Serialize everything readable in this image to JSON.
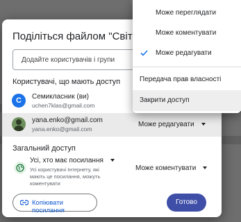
{
  "dialog": {
    "title": "Поділіться файлом \"Світ захо",
    "add_placeholder": "Додайте користувачів і групи",
    "people_heading": "Користувачі, що мають доступ",
    "people": [
      {
        "initial": "С",
        "name": "Семикласник (ви)",
        "email": "uchen7klas@gmail.com",
        "role": ""
      },
      {
        "initial": "",
        "name": "yana.enko@gmail.com",
        "email": "yana.enko@gmail.com",
        "role": "Може редагувати"
      }
    ],
    "general_heading": "Загальний доступ",
    "general": {
      "mode": "Усі, хто має посилання",
      "description": "Усі користувачі Інтернету, які мають це посилання, можуть коментувати",
      "role": "Може коментувати"
    },
    "copy_link_label": "Копіювати посилання",
    "done_label": "Готово"
  },
  "menu": {
    "roles": [
      {
        "label": "Може переглядати",
        "checked": false
      },
      {
        "label": "Може коментувати",
        "checked": false
      },
      {
        "label": "Може редагувати",
        "checked": true
      }
    ],
    "actions": [
      {
        "label": "Передача прав власності"
      },
      {
        "label": "Закрити доступ"
      }
    ]
  },
  "colors": {
    "accent": "#3f4fa8",
    "link": "#0b57d0",
    "avatar": "#1a73e8",
    "check": "#1a73e8"
  }
}
